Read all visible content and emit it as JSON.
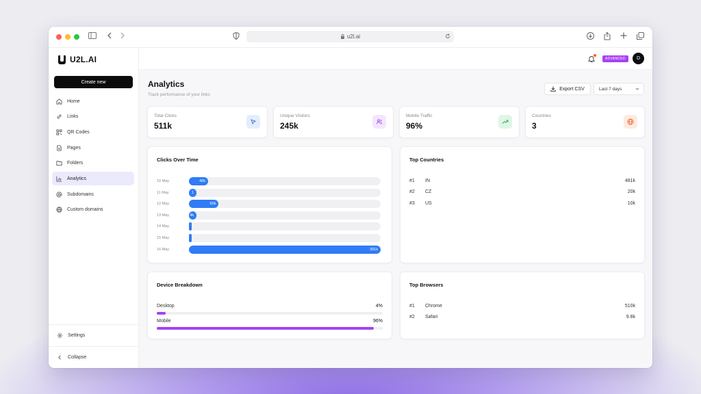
{
  "browser": {
    "url": "u2l.ai"
  },
  "brand": {
    "name": "U2L.AI"
  },
  "sidebar": {
    "create_label": "Create new",
    "items": [
      {
        "label": "Home",
        "icon": "home-icon",
        "active": false
      },
      {
        "label": "Links",
        "icon": "link-icon",
        "active": false
      },
      {
        "label": "QR Codes",
        "icon": "qr-code-icon",
        "active": false
      },
      {
        "label": "Pages",
        "icon": "page-icon",
        "active": false
      },
      {
        "label": "Folders",
        "icon": "folder-icon",
        "active": false
      },
      {
        "label": "Analytics",
        "icon": "analytics-icon",
        "active": true
      },
      {
        "label": "Subdomains",
        "icon": "at-sign-icon",
        "active": false
      },
      {
        "label": "Custom domains",
        "icon": "globe-icon",
        "active": false
      }
    ],
    "settings_label": "Settings",
    "collapse_label": "Collapse"
  },
  "topbar": {
    "plan_badge": "ADVANCED",
    "avatar_initial": "D"
  },
  "page": {
    "title": "Analytics",
    "subtitle": "Track performance of your links",
    "export_label": "Export CSV",
    "date_range": "Last 7 days"
  },
  "stats": [
    {
      "label": "Total Clicks",
      "value": "511k",
      "icon": "cursor-icon",
      "bg": "#e4edfd",
      "fg": "#2f6fe0"
    },
    {
      "label": "Unique Visitors",
      "value": "245k",
      "icon": "users-icon",
      "bg": "#f4e6fd",
      "fg": "#a742f5"
    },
    {
      "label": "Mobile Traffic",
      "value": "96%",
      "icon": "trend-up-icon",
      "bg": "#dff6e6",
      "fg": "#2aa85a"
    },
    {
      "label": "Countries",
      "value": "3",
      "icon": "globe-icon",
      "bg": "#fdebe2",
      "fg": "#e86a2c"
    }
  ],
  "clicks_over_time": {
    "title": "Clicks Over Time",
    "rows": [
      {
        "date": "10 May",
        "label": "40k",
        "fraction": 0.1
      },
      {
        "date": "11 May",
        "label": "1",
        "fraction": 0.04
      },
      {
        "date": "12 May",
        "label": "60k",
        "fraction": 0.155
      },
      {
        "date": "13 May",
        "label": "4k",
        "fraction": 0.04
      },
      {
        "date": "14 May",
        "label": "",
        "fraction": 0.012
      },
      {
        "date": "15 May",
        "label": "",
        "fraction": 0.012
      },
      {
        "date": "16 May",
        "label": "391k",
        "fraction": 1.0
      }
    ]
  },
  "top_countries": {
    "title": "Top Countries",
    "rows": [
      {
        "rank": "#1",
        "name": "IN",
        "value": "481k"
      },
      {
        "rank": "#2",
        "name": "CZ",
        "value": "20k"
      },
      {
        "rank": "#3",
        "name": "US",
        "value": "10k"
      }
    ]
  },
  "device_breakdown": {
    "title": "Device Breakdown",
    "rows": [
      {
        "name": "Desktop",
        "percent": "4%",
        "fraction": 0.04
      },
      {
        "name": "Mobile",
        "percent": "96%",
        "fraction": 0.96
      }
    ]
  },
  "top_browsers": {
    "title": "Top Browsers",
    "rows": [
      {
        "rank": "#1",
        "name": "Chrome",
        "value": "510k"
      },
      {
        "rank": "#2",
        "name": "Safari",
        "value": "9.8k"
      }
    ]
  }
}
